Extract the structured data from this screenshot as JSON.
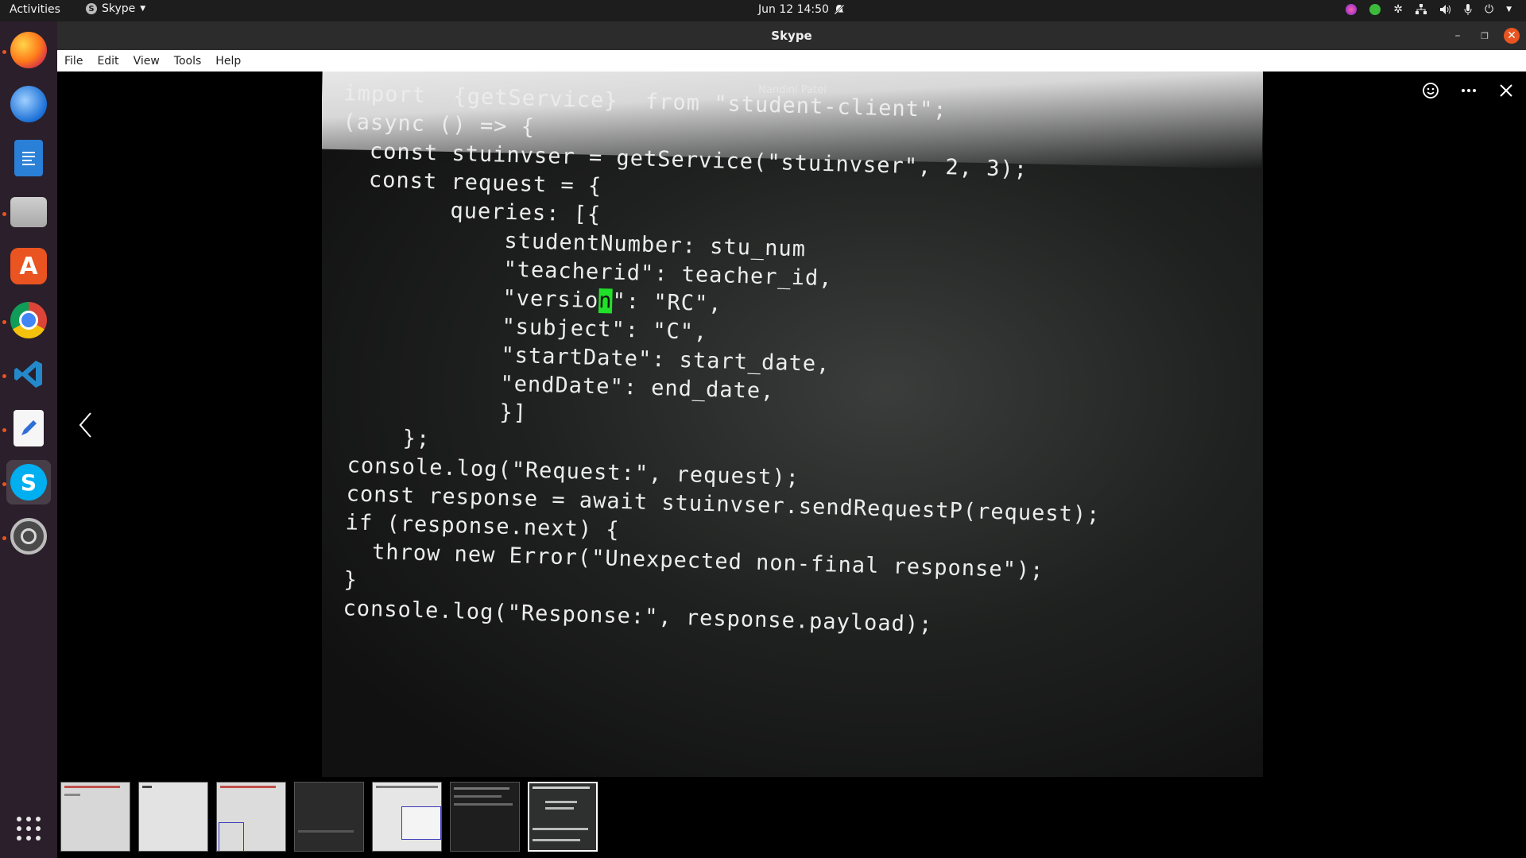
{
  "topbar": {
    "activities": "Activities",
    "app_name": "Skype",
    "datetime": "Jun 12  14:50"
  },
  "window": {
    "title": "Skype",
    "menu": [
      "File",
      "Edit",
      "View",
      "Tools",
      "Help"
    ]
  },
  "viewer": {
    "sender": "Nandini Patel",
    "code_lines": [
      "import  {getService}  from \"student-client\";",
      "",
      "(async () => {",
      "  const stuinvser = getService(\"stuinvser\", 2, 3);",
      "",
      "  const request = {",
      "        queries: [{",
      "            studentNumber: stu_num",
      "            \"teacherid\": teacher_id,",
      "            \"versio",
      "            \"subject\": \"C\",",
      "            \"startDate\": start_date,",
      "            \"endDate\": end_date,",
      "            }]",
      "     };",
      " console.log(\"Request:\", request);",
      " const response = await stuinvser.sendRequestP(request);",
      " if (response.next) {",
      "   throw new Error(\"Unexpected non-final response\");",
      " }",
      " console.log(\"Response:\", response.payload);"
    ],
    "cursor_char": "n",
    "version_tail": "\": \"RC\","
  },
  "colors": {
    "topbar_bg": "#1d1d1d",
    "dock_bg": "#2b1f2b",
    "accent_orange": "#e95420",
    "cursor_green": "#21e02a",
    "skype_blue": "#00aff0"
  },
  "dock_icons": [
    "firefox-icon",
    "thunderbird-icon",
    "writer-icon",
    "files-icon",
    "app-center-icon",
    "chrome-icon",
    "vscode-icon",
    "text-editor-icon",
    "skype-icon",
    "settings-icon",
    "show-apps-icon"
  ],
  "thumbnail_count": 7,
  "selected_thumbnail": 7
}
